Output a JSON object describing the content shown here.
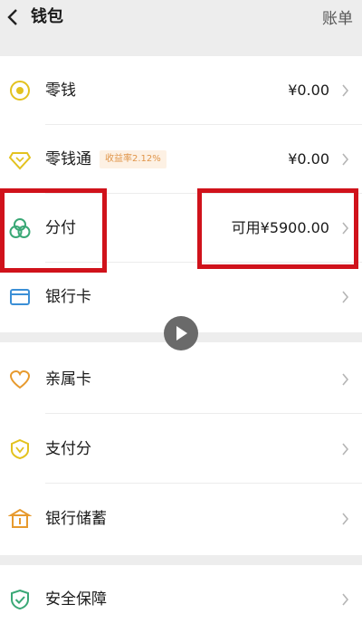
{
  "header": {
    "title": "钱包",
    "action": "账单"
  },
  "rows": [
    {
      "label": "零钱",
      "value": "¥0.00"
    },
    {
      "label": "零钱通",
      "badge": "收益率2.12%",
      "value": "¥0.00"
    },
    {
      "label": "分付",
      "value": "可用¥5900.00"
    },
    {
      "label": "银行卡"
    },
    {
      "label": "亲属卡"
    },
    {
      "label": "支付分"
    },
    {
      "label": "银行储蓄"
    },
    {
      "label": "安全保障"
    }
  ],
  "colors": {
    "highlight": "#d0121b",
    "icon_yellow": "#e3c21f",
    "icon_green": "#3aa876",
    "icon_blue": "#3b8fd6",
    "icon_orange": "#e79a2e"
  }
}
